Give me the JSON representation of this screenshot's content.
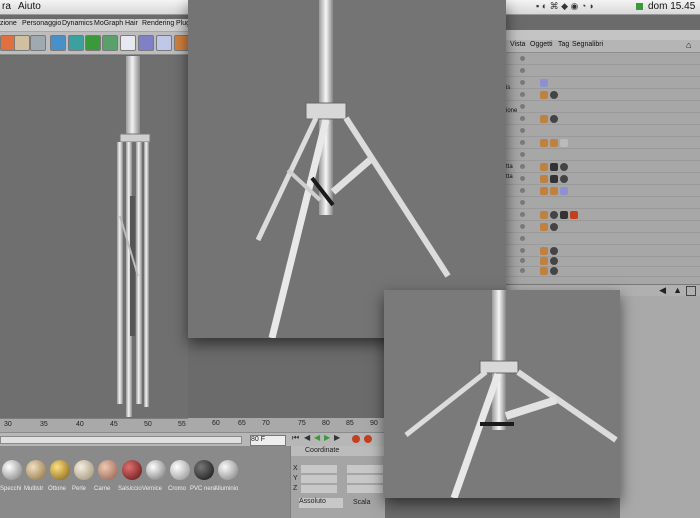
{
  "menubar": {
    "items": [
      "ra",
      "Aiuto"
    ],
    "clock": "dom 15.45"
  },
  "c4d_menu": {
    "items": [
      "zione",
      "Personaggio",
      "Dynamics",
      "MoGraph",
      "Hair",
      "Rendering",
      "Plug"
    ]
  },
  "object_manager": {
    "menu": [
      "Vista",
      "Oggetti",
      "Tag",
      "Segnalibri"
    ],
    "row_labels": [
      "is",
      "ione",
      "tta",
      "tta"
    ]
  },
  "timeline": {
    "ticks": [
      "30",
      "35",
      "40",
      "45",
      "50",
      "55",
      "60",
      "65",
      "70",
      "75",
      "80",
      "85",
      "90"
    ],
    "frame": "80 F"
  },
  "materials": {
    "labels": [
      "Specchi",
      "Multistr",
      "Ottone",
      "Perle",
      "Carne",
      "Salsiccio",
      "Vernice",
      "Cromo",
      "PVC nero",
      "Alluminio"
    ]
  },
  "coordinates": {
    "header": "Coordinate",
    "axes": [
      "X",
      "Y",
      "Z"
    ],
    "mode": "Assoluto",
    "scale": "Scala"
  },
  "colors": {
    "viewport": "#6f6f6f",
    "panel": "#a7a7a7",
    "accent_red": "#c24020",
    "accent_green": "#3a9a3a"
  }
}
